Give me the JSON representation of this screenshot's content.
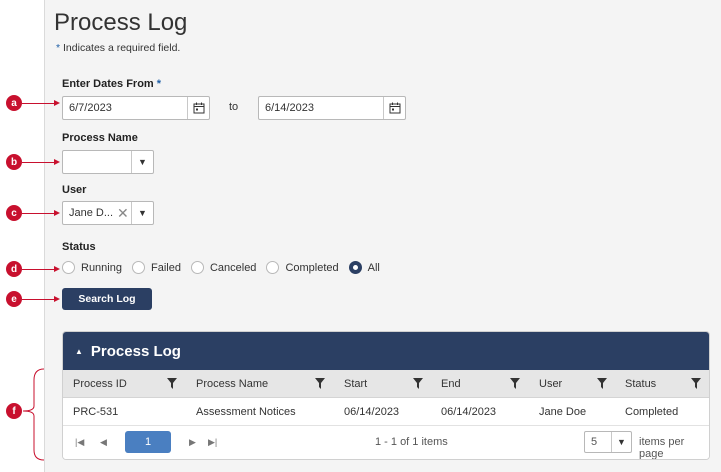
{
  "page": {
    "title": "Process Log",
    "required_star": "*",
    "required_note": " Indicates a required field."
  },
  "dates": {
    "label": "Enter Dates From",
    "required_star": "*",
    "from_value": "6/7/2023",
    "to_label": "to",
    "to_value": "6/14/2023"
  },
  "process_name": {
    "label": "Process Name",
    "value": ""
  },
  "user": {
    "label": "User",
    "value": "Jane D..."
  },
  "status": {
    "label": "Status",
    "options": [
      "Running",
      "Failed",
      "Canceled",
      "Completed",
      "All"
    ],
    "selected": "All"
  },
  "search_button": "Search Log",
  "grid": {
    "title": "Process Log",
    "columns": [
      "Process ID",
      "Process Name",
      "Start",
      "End",
      "User",
      "Status"
    ],
    "rows": [
      [
        "PRC-531",
        "Assessment Notices",
        "06/14/2023",
        "06/14/2023",
        "Jane Doe",
        "Completed"
      ]
    ],
    "pager": {
      "current_page": "1",
      "info": "1 - 1 of 1 items",
      "page_size": "5",
      "page_size_label": "items per page"
    }
  },
  "callouts": [
    "a",
    "b",
    "c",
    "d",
    "e",
    "f"
  ],
  "colors": {
    "header": "#2b3f63",
    "accent": "#4a7fc1",
    "callout": "#c8102e"
  }
}
